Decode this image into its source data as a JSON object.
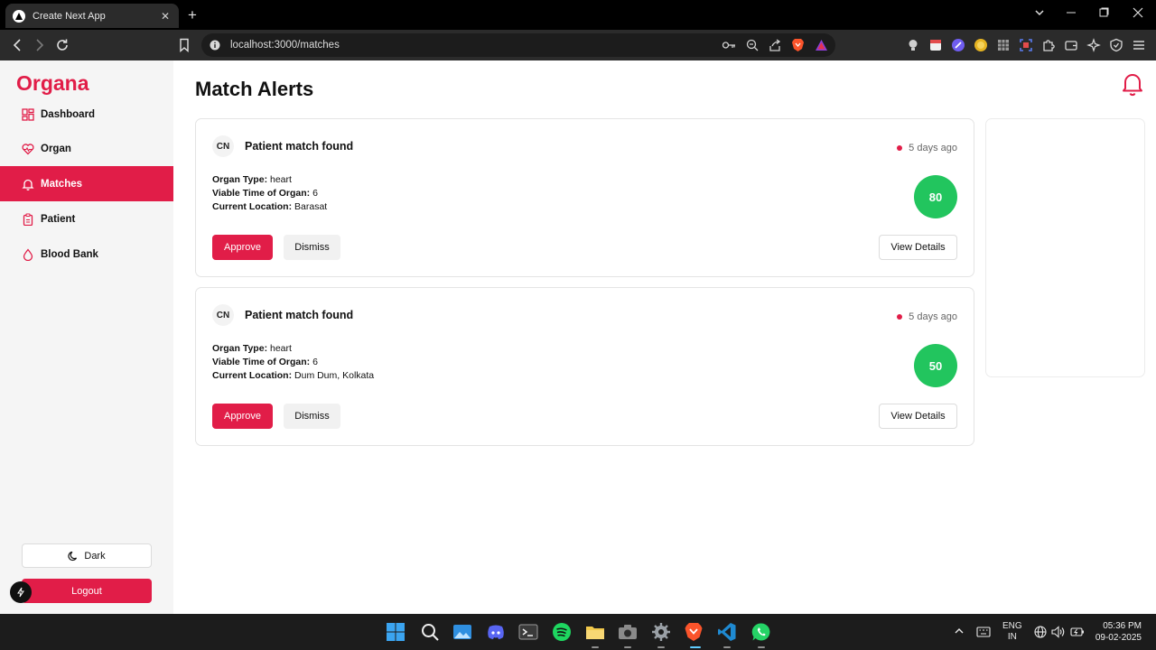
{
  "browser": {
    "tab_title": "Create Next App",
    "url": "localhost:3000/matches"
  },
  "sidebar": {
    "logo": "Organa",
    "items": [
      {
        "label": "Dashboard",
        "icon": "dashboard-icon"
      },
      {
        "label": "Organ",
        "icon": "heart-pulse-icon"
      },
      {
        "label": "Matches",
        "icon": "bell-icon",
        "active": true
      },
      {
        "label": "Patient",
        "icon": "clipboard-icon"
      },
      {
        "label": "Blood Bank",
        "icon": "droplet-icon"
      }
    ],
    "dark_label": "Dark",
    "logout_label": "Logout"
  },
  "main": {
    "title": "Match Alerts",
    "alerts": [
      {
        "avatar": "CN",
        "title": "Patient match found",
        "time": "5 days ago",
        "organ_type_label": "Organ Type:",
        "organ_type": "heart",
        "viable_time_label": "Viable Time of Organ:",
        "viable_time": "6",
        "location_label": "Current Location:",
        "location": "Barasat",
        "score": "80",
        "approve_label": "Approve",
        "dismiss_label": "Dismiss",
        "details_label": "View Details"
      },
      {
        "avatar": "CN",
        "title": "Patient match found",
        "time": "5 days ago",
        "organ_type_label": "Organ Type:",
        "organ_type": "heart",
        "viable_time_label": "Viable Time of Organ:",
        "viable_time": "6",
        "location_label": "Current Location:",
        "location": "Dum Dum, Kolkata",
        "score": "50",
        "approve_label": "Approve",
        "dismiss_label": "Dismiss",
        "details_label": "View Details"
      }
    ]
  },
  "taskbar": {
    "lang_line1": "ENG",
    "lang_line2": "IN",
    "time": "05:36 PM",
    "date": "09-02-2025"
  },
  "colors": {
    "accent": "#e11d48",
    "score_green": "#22c55e",
    "sidebar_bg": "#f5f5f5"
  }
}
